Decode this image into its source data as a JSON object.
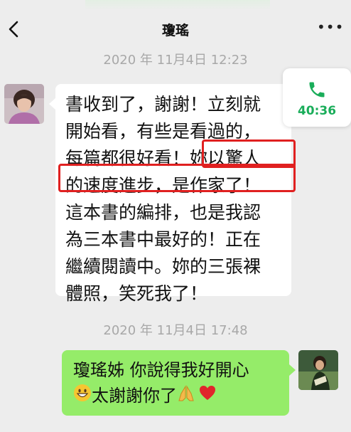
{
  "header": {
    "title": "瓊瑤",
    "more_label": "•••"
  },
  "messages": [
    {
      "timestamp": "2020 年 11月4日 12:23",
      "sender": "left",
      "lines": [
        "書收到了，謝謝！立刻就",
        "開始看，有些是看過的，",
        "每篇都很好看！妳以驚人",
        "的速度進步，是作家了！",
        "這本書的編排，也是我認",
        "為三本書中最好的！正在",
        "繼續閱讀中。妳的三張裸",
        "體照，笑死我了！"
      ]
    },
    {
      "timestamp": "2020 年 11月4日 17:48",
      "sender": "right",
      "lines": [
        "瓊瑤姊 你說得我好開心",
        "太謝謝你了"
      ],
      "emojis": [
        "grinning-face",
        "folded-hands",
        "red-heart"
      ]
    }
  ],
  "call_card": {
    "duration": "40:36",
    "icon": "phone-icon"
  },
  "colors": {
    "background": "#ededed",
    "sent_bubble": "#95ec69",
    "received_bubble": "#ffffff",
    "highlight_box": "#e02020",
    "call_green": "#1aad5a"
  }
}
